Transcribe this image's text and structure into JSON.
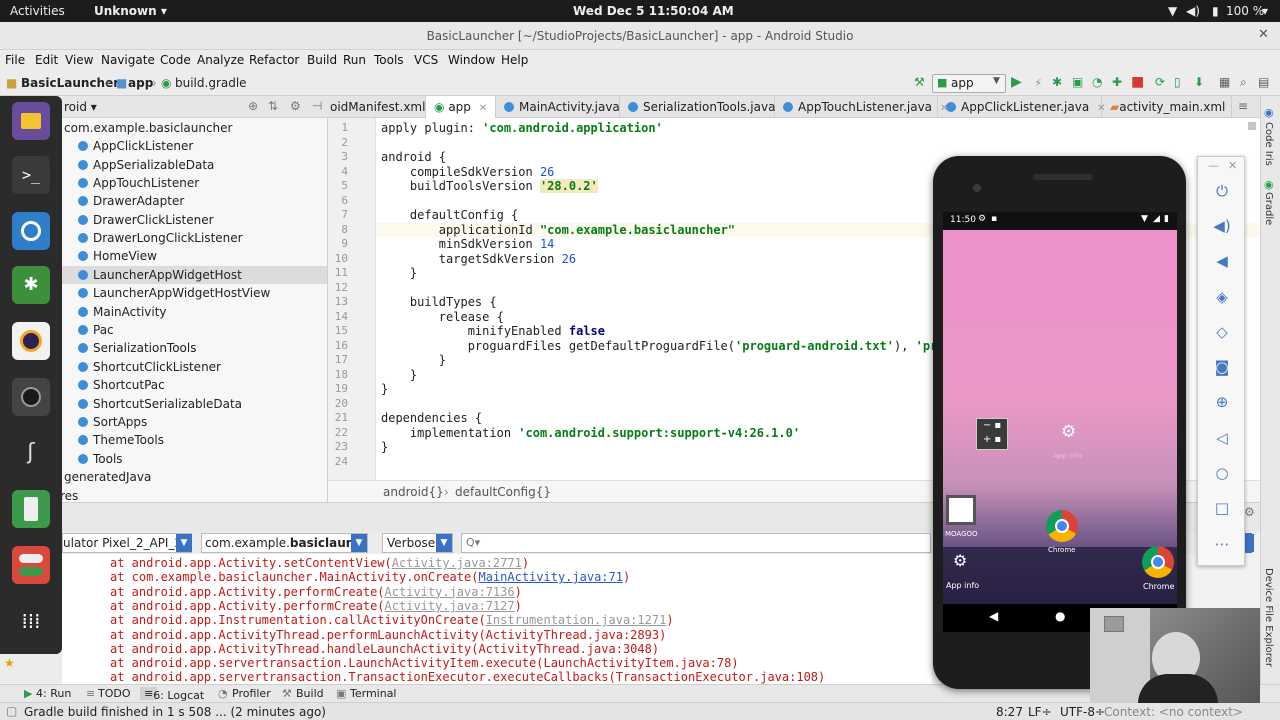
{
  "gnome": {
    "activities": "Activities",
    "app_menu": "Unknown ▾",
    "clock": "Wed Dec 5  11:50:04 AM",
    "battery": "100 %"
  },
  "window": {
    "title": "BasicLauncher [~/StudioProjects/BasicLauncher] - app - Android Studio"
  },
  "menu": [
    "File",
    "Edit",
    "View",
    "Navigate",
    "Code",
    "Analyze",
    "Refactor",
    "Build",
    "Run",
    "Tools",
    "VCS",
    "Window",
    "Help"
  ],
  "nav": {
    "project": "BasicLauncher",
    "module": "app",
    "file": "build.gradle",
    "run_config": "app"
  },
  "project": {
    "view": "roid ▾",
    "package": "com.example.basiclauncher",
    "classes": [
      "AppClickListener",
      "AppSerializableData",
      "AppTouchListener",
      "DrawerAdapter",
      "DrawerClickListener",
      "DrawerLongClickListener",
      "HomeView",
      "LauncherAppWidgetHost",
      "LauncherAppWidgetHostView",
      "MainActivity",
      "Pac",
      "SerializationTools",
      "ShortcutClickListener",
      "ShortcutPac",
      "ShortcutSerializableData",
      "SortApps",
      "ThemeTools",
      "Tools"
    ],
    "generated": "generatedJava",
    "res": "res"
  },
  "tabs": [
    "oidManifest.xml",
    "app",
    "MainActivity.java",
    "SerializationTools.java",
    "AppTouchListener.java",
    "AppClickListener.java",
    "activity_main.xml"
  ],
  "code_lines": [
    "1",
    "2",
    "3",
    "4",
    "5",
    "6",
    "7",
    "8",
    "9",
    "10",
    "11",
    "12",
    "13",
    "14",
    "15",
    "16",
    "17",
    "18",
    "19",
    "20",
    "21",
    "22",
    "23",
    "24"
  ],
  "code": {
    "l1a": "apply plugin: ",
    "l1b": "'com.android.application'",
    "l3": "android {",
    "l4a": "    compileSdkVersion ",
    "l4b": "26",
    "l5a": "    buildToolsVersion ",
    "l5b": "'28.0.2'",
    "l7": "    defaultConfig {",
    "l8a": "        applicationId ",
    "l8b": "\"com.example.basiclauncher\"",
    "l9a": "        minSdkVersion ",
    "l9b": "14",
    "l10a": "        targetSdkVersion ",
    "l10b": "26",
    "l11": "    }",
    "l13": "    buildTypes {",
    "l14": "        release {",
    "l15a": "            minifyEnabled ",
    "l15b": "false",
    "l16a": "            proguardFiles getDefaultProguardFile(",
    "l16b": "'proguard-android.txt'",
    "l16c": "), ",
    "l16d": "'pr",
    "l17": "        }",
    "l18": "    }",
    "l19": "}",
    "l21": "dependencies {",
    "l22a": "    implementation ",
    "l22b": "'com.android.support:support-v4:26.1.0'",
    "l23": "}"
  },
  "breadcrumb": [
    "android{}",
    "defaultConfig{}"
  ],
  "logcat": {
    "device": "ulator Pixel_2_API_2",
    "package_prefix": "com.example.",
    "package_bold": "basiclaunche",
    "level": "Verbose",
    "search_placeholder": "Q▾"
  },
  "log": [
    {
      "a": "at android.app.Activity.setContentView(",
      "b": "Activity.java:2771",
      "c": ")"
    },
    {
      "a": "at com.example.basiclauncher.MainActivity.onCreate(",
      "b": "MainActivity.java:71",
      "c": ")"
    },
    {
      "a": "at android.app.Activity.performCreate(",
      "b": "Activity.java:7136",
      "c": ")"
    },
    {
      "a": "at android.app.Activity.performCreate(",
      "b": "Activity.java:7127",
      "c": ")"
    },
    {
      "a": "at android.app.Instrumentation.callActivityOnCreate(",
      "b": "Instrumentation.java:1271",
      "c": ")"
    },
    {
      "a": "at android.app.ActivityThread.performLaunchActivity(ActivityThread.java:2893)",
      "b": "",
      "c": ""
    },
    {
      "a": "at android.app.ActivityThread.handleLaunchActivity(ActivityThread.java:3048)",
      "b": "",
      "c": ""
    },
    {
      "a": "at android.app.servertransaction.LaunchActivityItem.execute(LaunchActivityItem.java:78)",
      "b": "",
      "c": ""
    },
    {
      "a": "at android.app.servertransaction.TransactionExecutor.executeCallbacks(TransactionExecutor.java:108)",
      "b": "",
      "c": ""
    }
  ],
  "toolwindows": [
    "4: Run",
    "TODO",
    "6: Logcat",
    "Profiler",
    "Build",
    "Terminal"
  ],
  "status": {
    "message": "Gradle build finished in 1 s 508 ... (2 minutes ago)",
    "position": "8:27",
    "line_sep": "LF÷",
    "encoding": "UTF-8÷",
    "context": "Context: <no context>"
  },
  "sidebars": {
    "right_top": "Code Iris",
    "right_gradle": "Gradle",
    "right_bottom": "Device File Explorer"
  },
  "phone": {
    "time": "11:50",
    "icons": [
      {
        "label": "App info"
      },
      {
        "label": "MOAGOO"
      },
      {
        "label": "Chrome"
      },
      {
        "label": "App info"
      },
      {
        "label": "Chrome"
      }
    ]
  },
  "colors": {
    "accent": "#3d8ed6",
    "string": "#067d17",
    "keyword": "#000080",
    "error": "#c41a16"
  }
}
